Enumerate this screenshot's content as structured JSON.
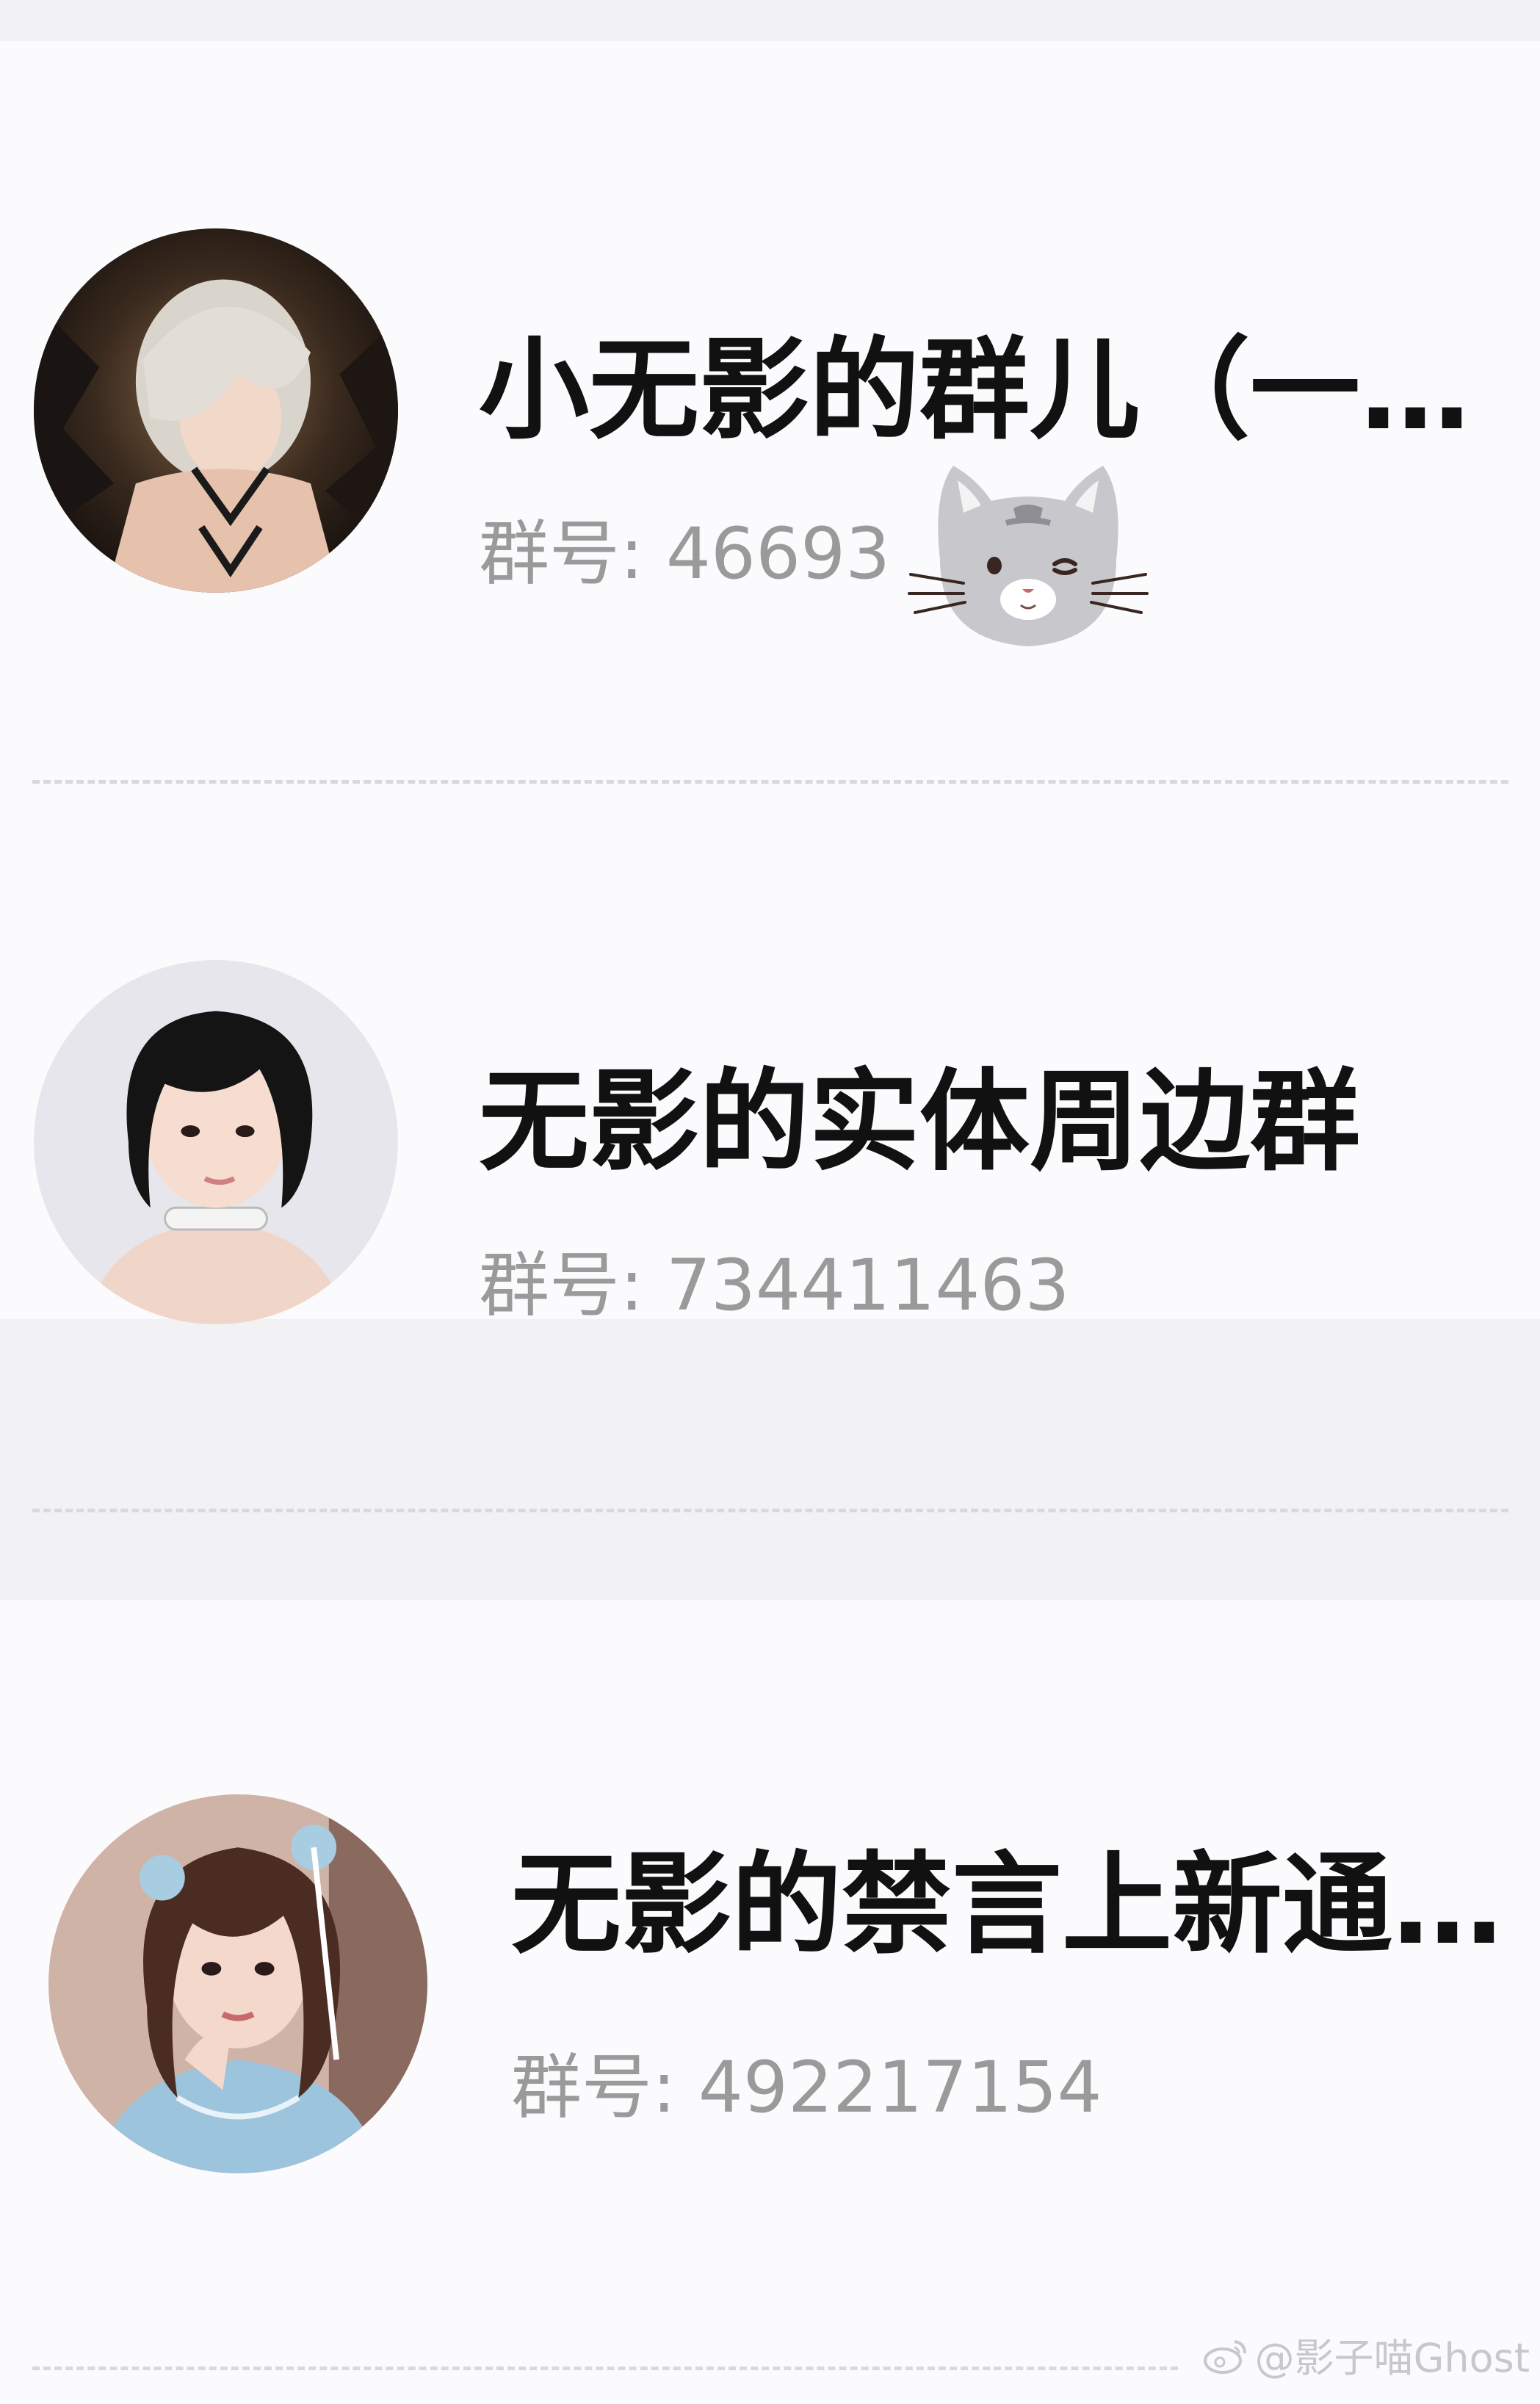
{
  "groups": [
    {
      "name": "小无影的群儿（一…",
      "id_label": "群号: 46693",
      "avatar": "avatar-silver-hair-cosplay"
    },
    {
      "name": "无影的实体周边群",
      "id_label": "群号: 734411463",
      "avatar": "avatar-black-bob-hair"
    },
    {
      "name": "无影的禁言上新通…",
      "id_label": "群号: 492217154",
      "avatar": "avatar-blue-qipao-cosplay"
    }
  ],
  "watermark": {
    "text": "@影子喵Ghost",
    "icon": "weibo-icon"
  },
  "sticker": {
    "icon": "winking-cat-sticker"
  },
  "colors": {
    "background": "#f2f2f4",
    "card": "#fbfbfd",
    "title": "#111111",
    "subtitle": "#9a9a9a",
    "divider": "#d9d9d9"
  }
}
